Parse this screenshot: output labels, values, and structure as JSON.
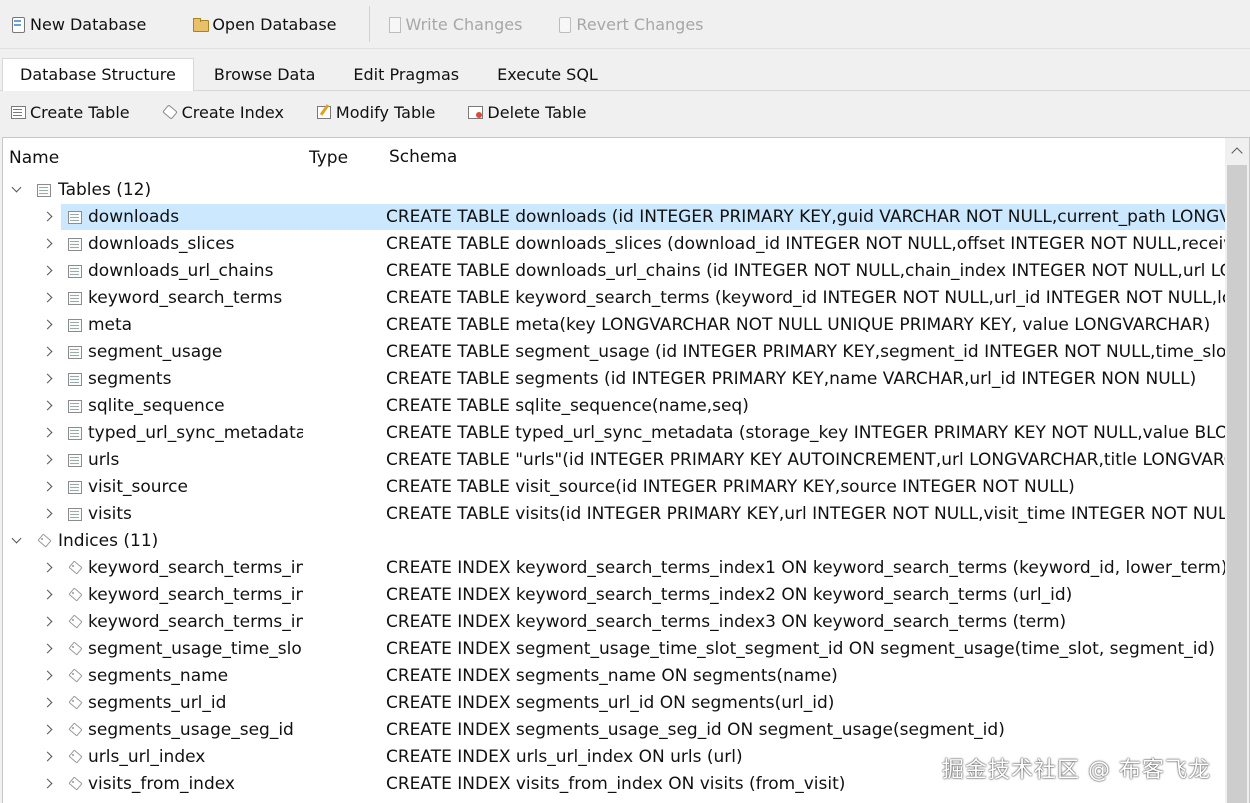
{
  "toolbar": {
    "new_database": "New Database",
    "open_database": "Open Database",
    "write_changes": "Write Changes",
    "revert_changes": "Revert Changes"
  },
  "tabs": [
    {
      "label": "Database Structure",
      "active": true
    },
    {
      "label": "Browse Data"
    },
    {
      "label": "Edit Pragmas"
    },
    {
      "label": "Execute SQL"
    }
  ],
  "structure_toolbar": {
    "create_table": "Create Table",
    "create_index": "Create Index",
    "modify_table": "Modify Table",
    "delete_table": "Delete Table"
  },
  "tree": {
    "columns": {
      "name": "Name",
      "type": "Type",
      "schema": "Schema"
    },
    "tables": {
      "label": "Tables (12)",
      "items": [
        {
          "name": "downloads",
          "schema": "CREATE TABLE downloads (id INTEGER PRIMARY KEY,guid VARCHAR NOT NULL,current_path LONGVARCHAR NOT NULL,target_path LONGVARCHAR NOT NULL"
        },
        {
          "name": "downloads_slices",
          "schema": "CREATE TABLE downloads_slices (download_id INTEGER NOT NULL,offset INTEGER NOT NULL,received_bytes INTEGER NOT NULL"
        },
        {
          "name": "downloads_url_chains",
          "schema": "CREATE TABLE downloads_url_chains (id INTEGER NOT NULL,chain_index INTEGER NOT NULL,url LONGVARCHAR NOT NULL"
        },
        {
          "name": "keyword_search_terms",
          "schema": "CREATE TABLE keyword_search_terms (keyword_id INTEGER NOT NULL,url_id INTEGER NOT NULL,lower_term LONGVARCHAR NOT NULL"
        },
        {
          "name": "meta",
          "schema": "CREATE TABLE meta(key LONGVARCHAR NOT NULL UNIQUE PRIMARY KEY, value LONGVARCHAR)"
        },
        {
          "name": "segment_usage",
          "schema": "CREATE TABLE segment_usage (id INTEGER PRIMARY KEY,segment_id INTEGER NOT NULL,time_slot INTEGER NOT NULL"
        },
        {
          "name": "segments",
          "schema": "CREATE TABLE segments (id INTEGER PRIMARY KEY,name VARCHAR,url_id INTEGER NON NULL)"
        },
        {
          "name": "sqlite_sequence",
          "schema": "CREATE TABLE sqlite_sequence(name,seq)"
        },
        {
          "name": "typed_url_sync_metadata",
          "schema": "CREATE TABLE typed_url_sync_metadata (storage_key INTEGER PRIMARY KEY NOT NULL,value BLOB)"
        },
        {
          "name": "urls",
          "schema": "CREATE TABLE \"urls\"(id INTEGER PRIMARY KEY AUTOINCREMENT,url LONGVARCHAR,title LONGVARCHAR,visit_count INTEGER"
        },
        {
          "name": "visit_source",
          "schema": "CREATE TABLE visit_source(id INTEGER PRIMARY KEY,source INTEGER NOT NULL)"
        },
        {
          "name": "visits",
          "schema": "CREATE TABLE visits(id INTEGER PRIMARY KEY,url INTEGER NOT NULL,visit_time INTEGER NOT NULL,from_visit INTEGER"
        }
      ]
    },
    "indices": {
      "label": "Indices (11)",
      "items": [
        {
          "name": "keyword_search_terms_in...",
          "schema": "CREATE INDEX keyword_search_terms_index1 ON keyword_search_terms (keyword_id, lower_term)"
        },
        {
          "name": "keyword_search_terms_in...",
          "schema": "CREATE INDEX keyword_search_terms_index2 ON keyword_search_terms (url_id)"
        },
        {
          "name": "keyword_search_terms_in...",
          "schema": "CREATE INDEX keyword_search_terms_index3 ON keyword_search_terms (term)"
        },
        {
          "name": "segment_usage_time_slo...",
          "schema": "CREATE INDEX segment_usage_time_slot_segment_id ON segment_usage(time_slot, segment_id)"
        },
        {
          "name": "segments_name",
          "schema": "CREATE INDEX segments_name ON segments(name)"
        },
        {
          "name": "segments_url_id",
          "schema": "CREATE INDEX segments_url_id ON segments(url_id)"
        },
        {
          "name": "segments_usage_seg_id",
          "schema": "CREATE INDEX segments_usage_seg_id ON segment_usage(segment_id)"
        },
        {
          "name": "urls_url_index",
          "schema": "CREATE INDEX urls_url_index ON urls (url)"
        },
        {
          "name": "visits_from_index",
          "schema": "CREATE INDEX visits_from_index ON visits (from_visit)"
        }
      ]
    }
  },
  "watermark": "掘金技术社区 @ 布客飞龙"
}
